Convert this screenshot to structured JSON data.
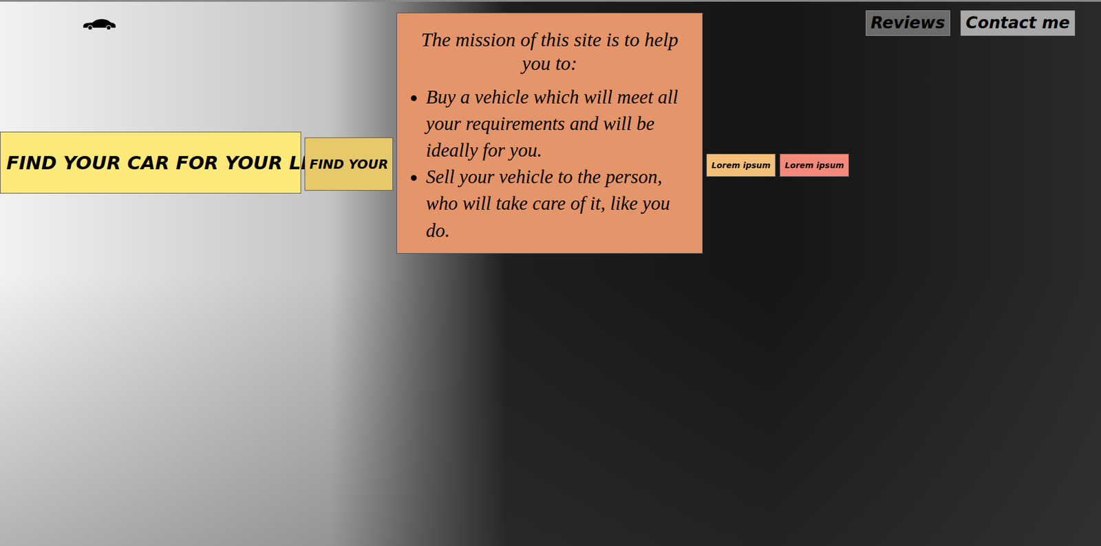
{
  "nav": [
    {
      "label": "Reviews",
      "color": "#6b6b6b"
    },
    {
      "label": "Contact me",
      "color": "#a9a9a9"
    }
  ],
  "banner": {
    "title": "FIND YOUR CAR FOR YOUR LIFE!",
    "button": "FIND YOUR"
  },
  "mission": {
    "title": "The mission of this site is to help you to:",
    "items": [
      "Buy a vehicle which will meet all your requirements and will be ideally for you.",
      "Sell your vehicle to the person, who will take care of it, like you do."
    ]
  },
  "buttons": [
    {
      "label": "Lorem ipsum",
      "color": "#f4c078"
    },
    {
      "label": "Lorem ipsum",
      "color": "#f4897a"
    }
  ]
}
